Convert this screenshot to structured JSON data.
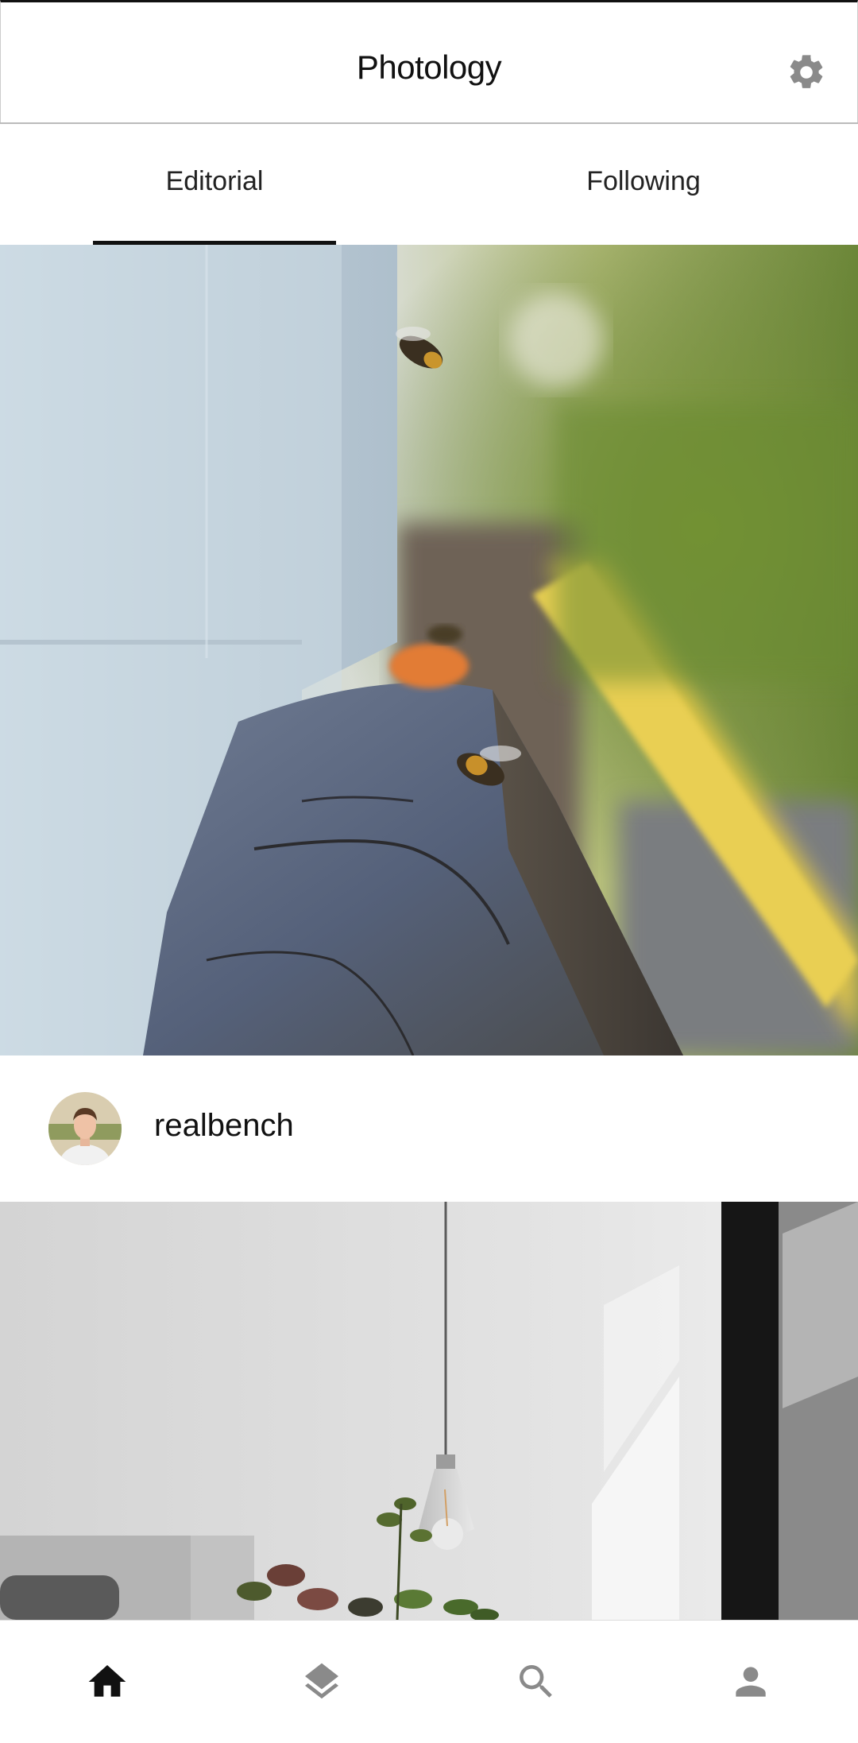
{
  "app": {
    "title": "Photology"
  },
  "icons": {
    "settings": "gear-icon",
    "home": "home-icon",
    "collections": "layers-icon",
    "search": "search-icon",
    "profile": "person-icon"
  },
  "tabs": [
    {
      "label": "Editorial",
      "active": true
    },
    {
      "label": "Following",
      "active": false
    }
  ],
  "feed": {
    "posts": [
      {
        "author": "realbench"
      }
    ]
  },
  "colors": {
    "active_icon": "#111111",
    "inactive_icon": "#8a8a8a",
    "indicator": "#111111"
  }
}
